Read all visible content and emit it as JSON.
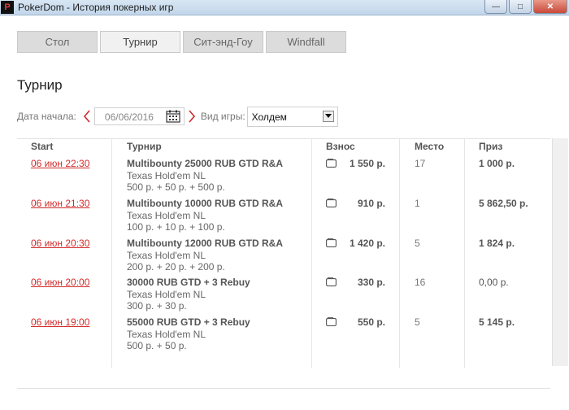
{
  "window": {
    "title": "PokerDom - История покерных игр",
    "logo": "P"
  },
  "tabs": [
    {
      "label": "Стол"
    },
    {
      "label": "Турнир"
    },
    {
      "label": "Сит-энд-Гоу"
    },
    {
      "label": "Windfall"
    }
  ],
  "page": {
    "title": "Турнир"
  },
  "filters": {
    "start_date_label": "Дата начала:",
    "start_date_value": "06/06/2016",
    "game_type_label": "Вид игры:",
    "game_type_value": "Холдем"
  },
  "table": {
    "headers": {
      "start": "Start",
      "tournament": "Турнир",
      "fee": "Взнос",
      "place": "Место",
      "prize": "Приз"
    },
    "rows": [
      {
        "time": "06 июн 22:30",
        "name": "Multibounty 25000 RUB GTD R&A",
        "game": "Texas Hold'em NL",
        "buyin": "500 р. + 50 р. + 500 р.",
        "fee": "1 550 р.",
        "place": "17",
        "prize": "1 000 р."
      },
      {
        "time": "06 июн 21:30",
        "name": "Multibounty 10000 RUB GTD R&A",
        "game": "Texas Hold'em NL",
        "buyin": "100 р. + 10 р. + 100 р.",
        "fee": "910 р.",
        "place": "1",
        "prize": "5 862,50 р."
      },
      {
        "time": "06 июн 20:30",
        "name": "Multibounty 12000 RUB GTD R&A",
        "game": "Texas Hold'em NL",
        "buyin": "200 р. + 20 р. + 200 р.",
        "fee": "1 420 р.",
        "place": "5",
        "prize": "1 824 р."
      },
      {
        "time": "06 июн 20:00",
        "name": "30000 RUB GTD + 3 Rebuy",
        "game": "Texas Hold'em NL",
        "buyin": "300 р. + 30 р.",
        "fee": "330 р.",
        "place": "16",
        "prize": "0,00 р."
      },
      {
        "time": "06 июн 19:00",
        "name": "55000 RUB GTD + 3 Rebuy",
        "game": "Texas Hold'em NL",
        "buyin": "500 р. + 50 р.",
        "fee": "550 р.",
        "place": "5",
        "prize": "5 145 р."
      }
    ]
  },
  "colors": {
    "accent_red": "#d12a2a",
    "titlebar": "#c2d6ea"
  }
}
